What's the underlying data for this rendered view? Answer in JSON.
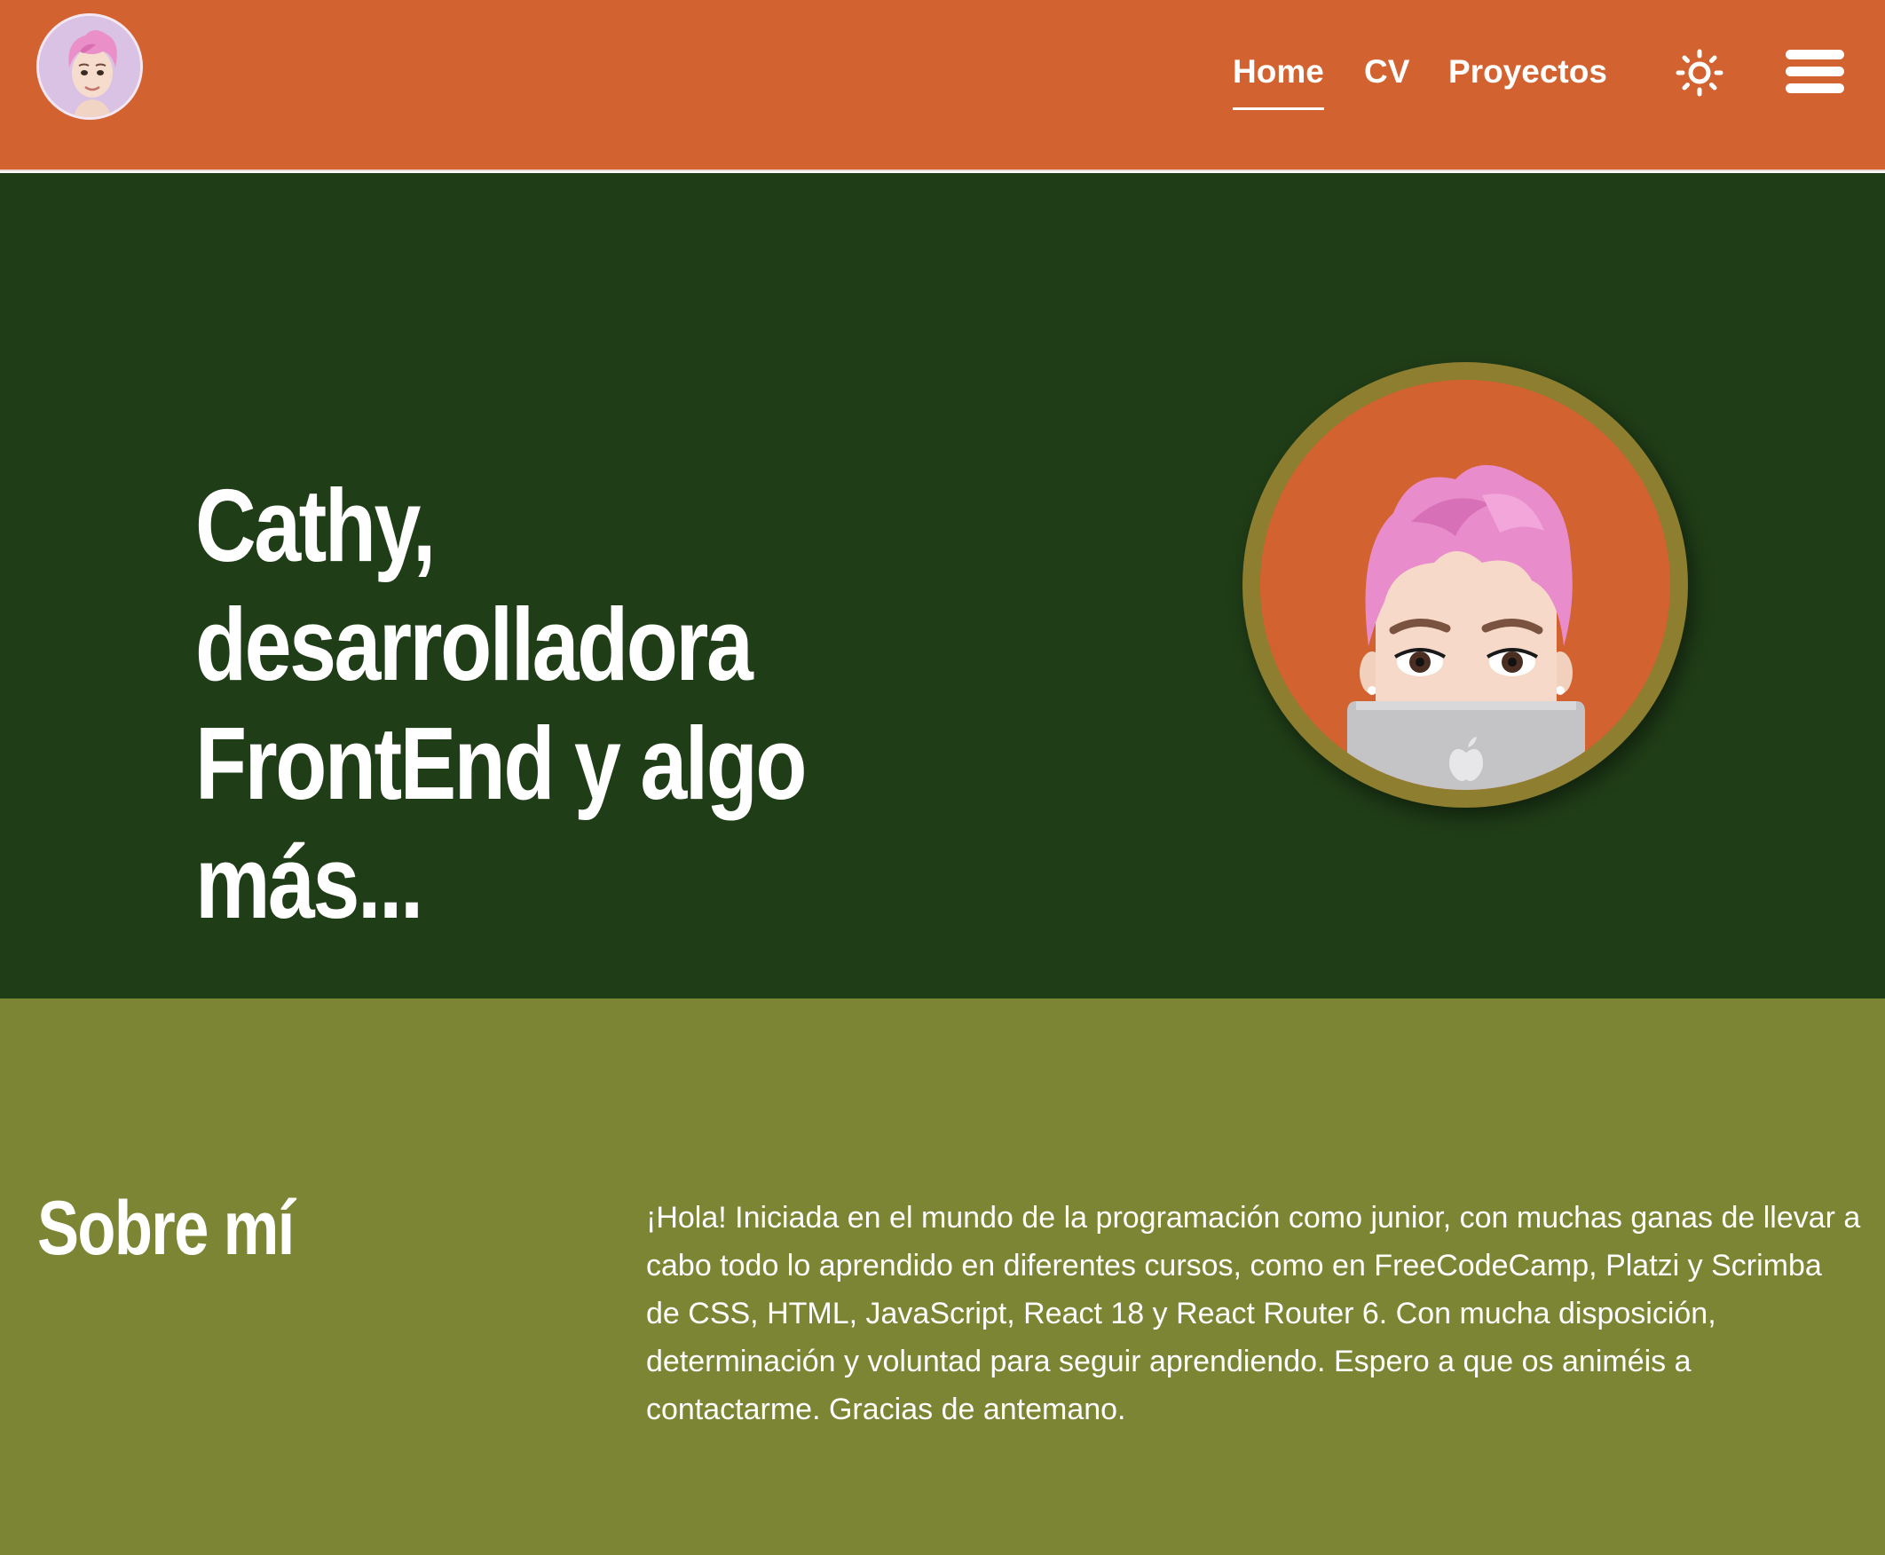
{
  "header": {
    "logo_icon": "memoji-avatar-icon",
    "nav": [
      {
        "label": "Home",
        "active": true
      },
      {
        "label": "CV",
        "active": false
      },
      {
        "label": "Proyectos",
        "active": false
      }
    ],
    "theme_icon": "sun-icon",
    "menu_icon": "hamburger-menu-icon"
  },
  "hero": {
    "title_line1": "Cathy, desarrolladora",
    "title_line2": "FrontEnd y algo más...",
    "avatar_icon": "memoji-laptop-avatar-icon"
  },
  "about": {
    "heading": "Sobre mí",
    "text": "¡Hola! Iniciada en el mundo de la programación como junior, con muchas ganas de llevar a cabo todo lo aprendido en diferentes cursos, como en FreeCodeCamp, Platzi y Scrimba de CSS, HTML, JavaScript, React 18 y React Router 6. Con mucha disposición, determinación y voluntad para seguir aprendiendo. Espero a que os animéis a contactarme. Gracias de antemano."
  },
  "colors": {
    "header_bg": "#D2622F",
    "hero_bg": "#1F3D17",
    "about_bg": "#7C8533",
    "avatar_ring": "#8D7E30",
    "text": "#FFFFFF"
  }
}
